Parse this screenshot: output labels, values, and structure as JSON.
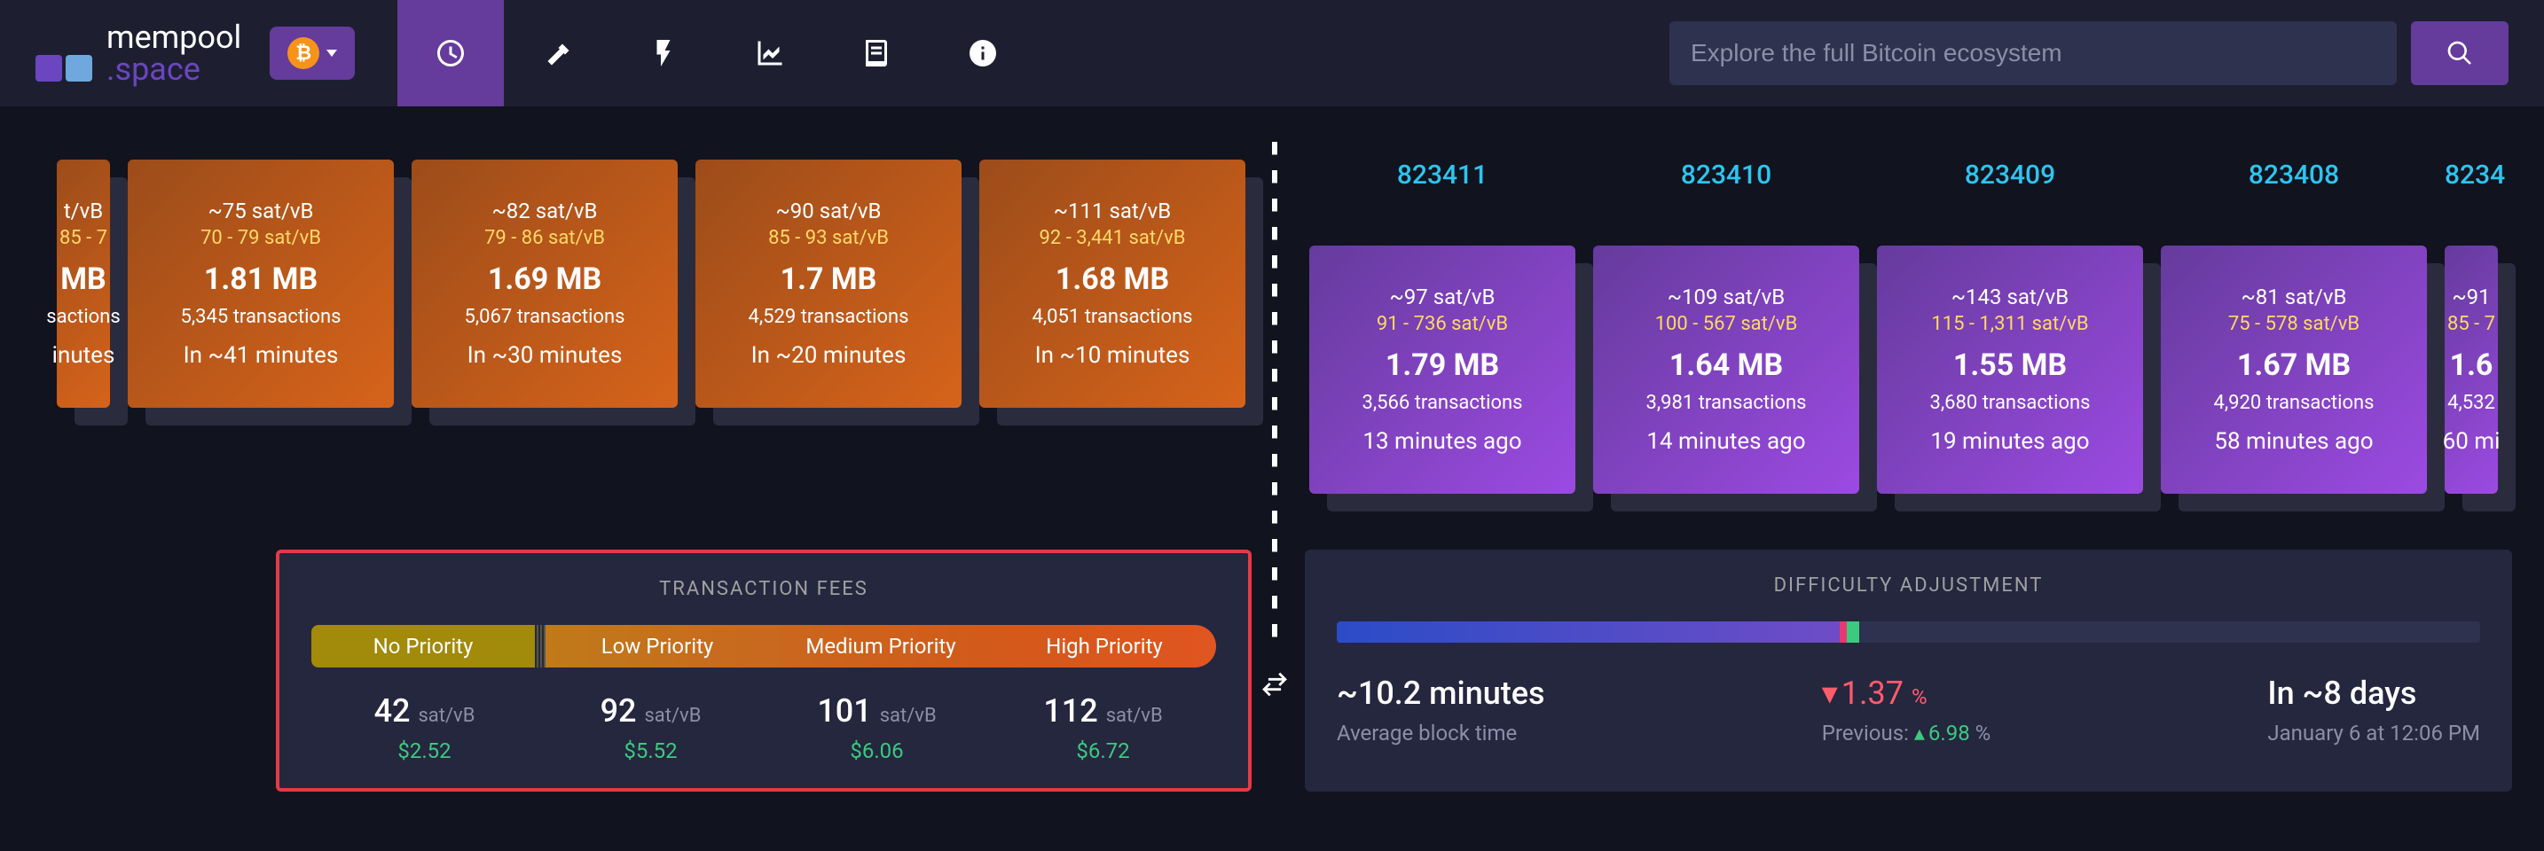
{
  "nav": {
    "logo_top": "mempool",
    "logo_bot": ".space",
    "search_placeholder": "Explore the full Bitcoin ecosystem"
  },
  "pending_blocks": [
    {
      "fee": "~75 sat/vB",
      "range": "70 - 79 sat/vB",
      "size": "1.81 MB",
      "tx": "5,345 transactions",
      "time": "In ~41 minutes"
    },
    {
      "fee": "~82 sat/vB",
      "range": "79 - 86 sat/vB",
      "size": "1.69 MB",
      "tx": "5,067 transactions",
      "time": "In ~30 minutes"
    },
    {
      "fee": "~90 sat/vB",
      "range": "85 - 93 sat/vB",
      "size": "1.7 MB",
      "tx": "4,529 transactions",
      "time": "In ~20 minutes"
    },
    {
      "fee": "~111 sat/vB",
      "range": "92 - 3,441 sat/vB",
      "size": "1.68 MB",
      "tx": "4,051 transactions",
      "time": "In ~10 minutes"
    }
  ],
  "pending_partial": {
    "fee": "t/vB",
    "range": "85 - 7",
    "size": "MB",
    "tx": "sactions",
    "time": "inutes"
  },
  "mined_blocks": [
    {
      "num": "823411",
      "fee": "~97 sat/vB",
      "range": "91 - 736 sat/vB",
      "size": "1.79 MB",
      "tx": "3,566 transactions",
      "time": "13 minutes ago"
    },
    {
      "num": "823410",
      "fee": "~109 sat/vB",
      "range": "100 - 567 sat/vB",
      "size": "1.64 MB",
      "tx": "3,981 transactions",
      "time": "14 minutes ago"
    },
    {
      "num": "823409",
      "fee": "~143 sat/vB",
      "range": "115 - 1,311 sat/vB",
      "size": "1.55 MB",
      "tx": "3,680 transactions",
      "time": "19 minutes ago"
    },
    {
      "num": "823408",
      "fee": "~81 sat/vB",
      "range": "75 - 578 sat/vB",
      "size": "1.67 MB",
      "tx": "4,920 transactions",
      "time": "58 minutes ago"
    }
  ],
  "mined_partial": {
    "num": "8234",
    "fee": "~91",
    "range": "85 - 7",
    "size": "1.6",
    "tx": "4,532",
    "time": "60 mi"
  },
  "fees": {
    "title": "TRANSACTION FEES",
    "headers": [
      "No Priority",
      "Low Priority",
      "Medium Priority",
      "High Priority"
    ],
    "rows": [
      {
        "val": "42",
        "usd": "$2.52"
      },
      {
        "val": "92",
        "usd": "$5.52"
      },
      {
        "val": "101",
        "usd": "$6.06"
      },
      {
        "val": "112",
        "usd": "$6.72"
      }
    ],
    "unit": "sat/vB"
  },
  "difficulty": {
    "title": "DIFFICULTY ADJUSTMENT",
    "avg_time": "~10.2 minutes",
    "avg_label": "Average block time",
    "pct": "1.37",
    "pct_unit": "%",
    "prev_label": "Previous:",
    "prev_pct": "6.98",
    "prev_unit": "%",
    "in_days": "In ~8 days",
    "date": "January 6 at 12:06 PM"
  }
}
